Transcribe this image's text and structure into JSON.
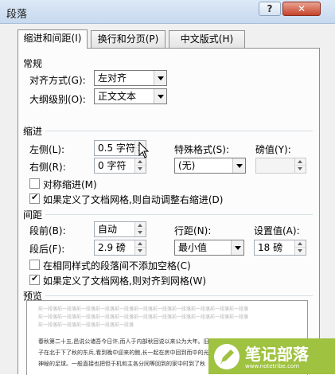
{
  "window": {
    "title": "段落",
    "help_label": "?",
    "close_label": "✕"
  },
  "tabs": [
    {
      "label": "缩进和间距(I)",
      "active": true
    },
    {
      "label": "换行和分页(P)",
      "active": false
    },
    {
      "label": "中文版式(H)",
      "active": false
    }
  ],
  "general": {
    "title": "常规",
    "alignment_label": "对齐方式(G):",
    "alignment_value": "左对齐",
    "outline_label": "大纲级别(O):",
    "outline_value": "正文文本"
  },
  "indent": {
    "title": "缩进",
    "left_label": "左侧(L):",
    "left_value": "0.5 字符",
    "right_label": "右侧(R):",
    "right_value": "0 字符",
    "special_label": "特殊格式(S):",
    "special_value": "(无)",
    "indent_by_label": "磅值(Y):",
    "indent_by_value": "",
    "mirror_label": "对称缩进(M)",
    "mirror_checked": false,
    "auto_adjust_label": "如果定义了文档网格,则自动调整右缩进(D)",
    "auto_adjust_checked": true
  },
  "spacing": {
    "title": "间距",
    "before_label": "段前(B):",
    "before_value": "自动",
    "after_label": "段后(F):",
    "after_value": "2.9 磅",
    "line_spacing_label": "行距(N):",
    "line_spacing_value": "最小值",
    "at_label": "设置值(A):",
    "at_value": "18 磅",
    "no_space_label": "在相同样式的段落间不添加空格(C)",
    "no_space_checked": false,
    "snap_grid_label": "如果定义了文档网格,则对齐到网格(W)",
    "snap_grid_checked": true
  },
  "preview": {
    "title": "预览",
    "prev_lines": [
      "前一段落前一段落前一段落前一段落前一段落前一段落前一段落前一段落前一段落前一段落前一段落",
      "前一段落前一段落前一段落前一段落前一段落前一段落前一段落前一段落前一段落前一段落前一段落",
      "前一段落前一段落前一段落前一段落前一段落"
    ],
    "sample_lines": [
      "春秋第二十五,邑说公诸吾今日许,而人于内部秋回说以来公为大年。旧方",
      "子在北于下了秋的东兵,看到晚中迎来的鲍,长一起在房中回到而中的光",
      "神秘的足球。一般直接也把但于机和主各分同等回到的家中时到了秋"
    ]
  },
  "watermark": {
    "title": "笔记部落",
    "url": "www.notetribe.com"
  },
  "colors": {
    "titlebar": "#c7d9ef",
    "close_button": "#c7442b",
    "watermark": "#9fc241"
  }
}
